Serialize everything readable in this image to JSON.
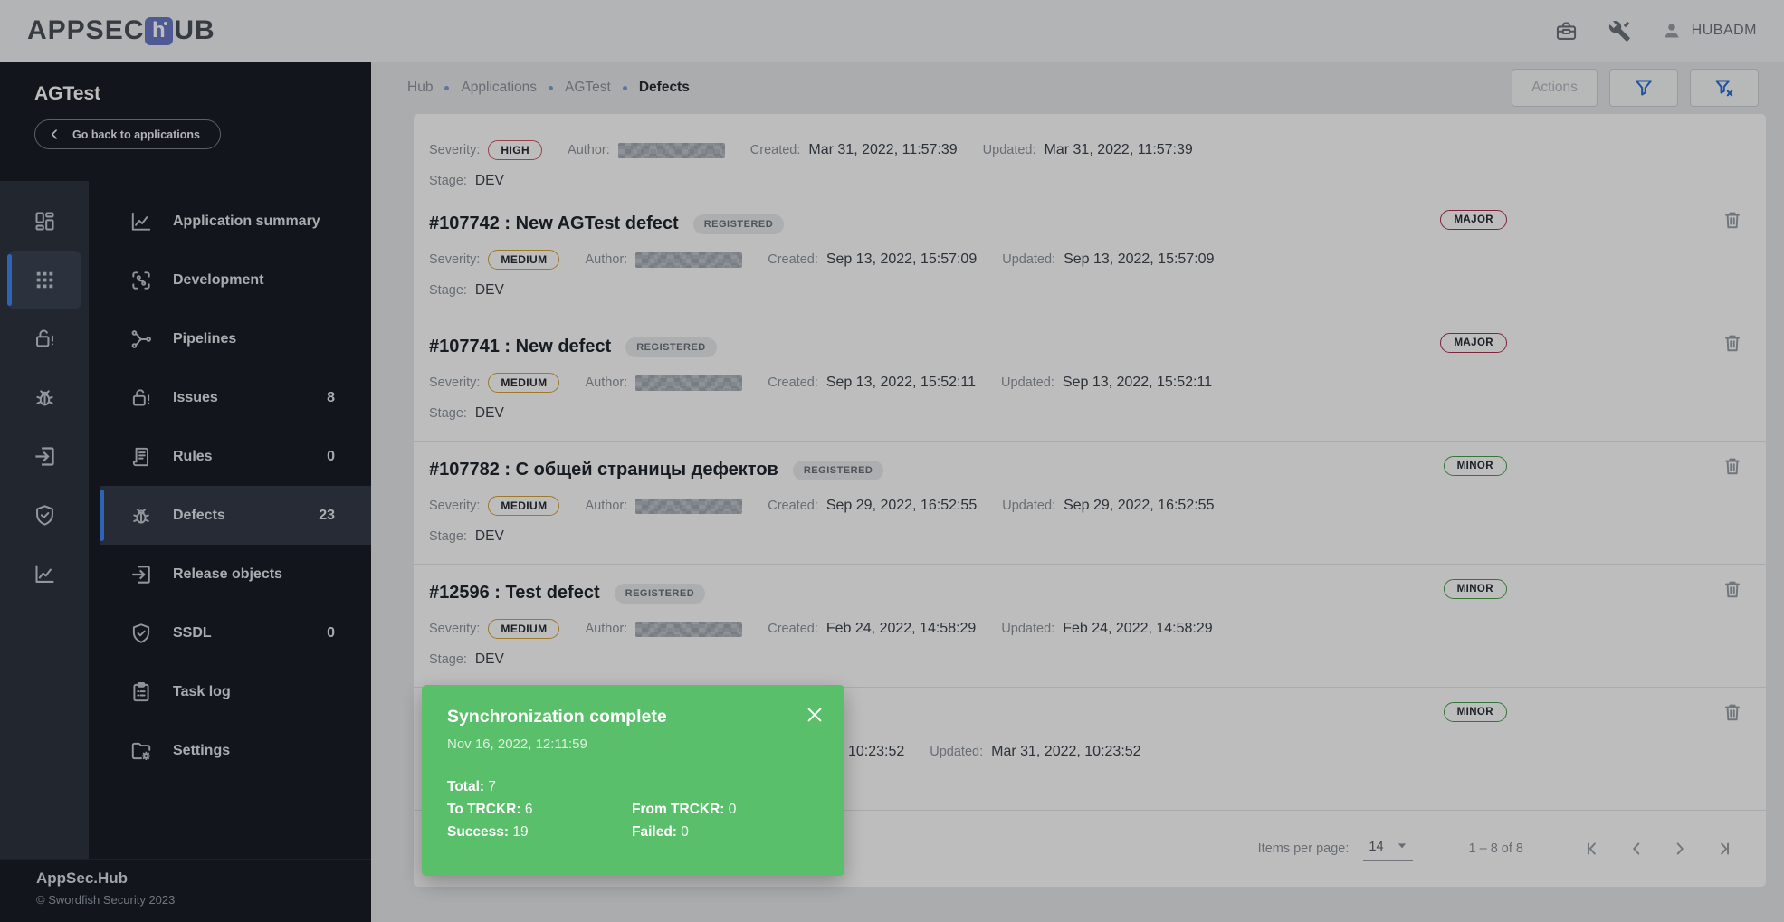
{
  "app_bar": {
    "logo_prefix": "APPSEC",
    "logo_mid": "h",
    "logo_suffix": "UB",
    "user": "HUBADM"
  },
  "icons": {
    "toolbox-icon": "briefcase outline",
    "tools-icon": "crossed wrench tools",
    "person-icon": "user silhouette",
    "chevron-left-icon": "left chevron",
    "filter-icon": "funnel outline",
    "filter-clear-icon": "funnel with x",
    "trash-icon": "trash can outline",
    "close-icon": "x cross",
    "caret-down-icon": "filled down triangle",
    "first-page-icon": "bar + left chevron",
    "chevron-left-nav-icon": "left chevron",
    "chevron-right-nav-icon": "right chevron",
    "last-page-icon": "right chevron + bar"
  },
  "sidebar": {
    "app_name": "AGTest",
    "back_label": "Go back to applications",
    "rail": [
      {
        "name": "dashboard",
        "icon": "dashboard-icon",
        "selected": false
      },
      {
        "name": "applications",
        "icon": "apps-grid-icon",
        "selected": true
      },
      {
        "name": "issues",
        "icon": "lock-alert-icon",
        "selected": false
      },
      {
        "name": "defects",
        "icon": "bug-icon",
        "selected": false
      },
      {
        "name": "release-objects",
        "icon": "exit-icon",
        "selected": false
      },
      {
        "name": "ssdl",
        "icon": "shield-check-icon",
        "selected": false
      },
      {
        "name": "reports",
        "icon": "chart-icon",
        "selected": false
      }
    ],
    "menu": [
      {
        "label": "Application summary",
        "icon": "line-chart-icon",
        "count": "",
        "selected": false
      },
      {
        "label": "Development",
        "icon": "dev-scan-icon",
        "count": "",
        "selected": false
      },
      {
        "label": "Pipelines",
        "icon": "pipelines-icon",
        "count": "",
        "selected": false
      },
      {
        "label": "Issues",
        "icon": "lock-alert-icon",
        "count": "8",
        "selected": false
      },
      {
        "label": "Rules",
        "icon": "rules-icon",
        "count": "0",
        "selected": false
      },
      {
        "label": "Defects",
        "icon": "bug-icon",
        "count": "23",
        "selected": true
      },
      {
        "label": "Release objects",
        "icon": "exit-icon",
        "count": "",
        "selected": false
      },
      {
        "label": "SSDL",
        "icon": "shield-check-icon",
        "count": "0",
        "selected": false
      },
      {
        "label": "Task log",
        "icon": "task-log-icon",
        "count": "",
        "selected": false
      },
      {
        "label": "Settings",
        "icon": "folder-gear-icon",
        "count": "",
        "selected": false
      }
    ],
    "footer_title": "AppSec.Hub",
    "footer_copyright": "© Swordfish Security 2023"
  },
  "breadcrumb": {
    "items": [
      "Hub",
      "Applications",
      "AGTest"
    ],
    "current": "Defects"
  },
  "toolbar": {
    "actions_label": "Actions"
  },
  "labels": {
    "severity": "Severity:",
    "author": "Author:",
    "created": "Created:",
    "updated": "Updated:",
    "stage": "Stage:"
  },
  "defects": [
    {
      "clipped": true,
      "title": "",
      "status": "",
      "severity": "HIGH",
      "created": "Mar 31, 2022, 11:57:39",
      "updated": "Mar 31, 2022, 11:57:39",
      "stage": "DEV",
      "level": ""
    },
    {
      "clipped": false,
      "title": "#107742 : New AGTest defect",
      "status": "REGISTERED",
      "severity": "MEDIUM",
      "created": "Sep 13, 2022, 15:57:09",
      "updated": "Sep 13, 2022, 15:57:09",
      "stage": "DEV",
      "level": "MAJOR"
    },
    {
      "clipped": false,
      "title": "#107741 : New defect",
      "status": "REGISTERED",
      "severity": "MEDIUM",
      "created": "Sep 13, 2022, 15:52:11",
      "updated": "Sep 13, 2022, 15:52:11",
      "stage": "DEV",
      "level": "MAJOR"
    },
    {
      "clipped": false,
      "title": "#107782 : С общей страницы дефектов",
      "status": "REGISTERED",
      "severity": "MEDIUM",
      "created": "Sep 29, 2022, 16:52:55",
      "updated": "Sep 29, 2022, 16:52:55",
      "stage": "DEV",
      "level": "MINOR"
    },
    {
      "clipped": false,
      "title": "#12596 : Test defect",
      "status": "REGISTERED",
      "severity": "MEDIUM",
      "created": "Feb 24, 2022, 14:58:29",
      "updated": "Feb 24, 2022, 14:58:29",
      "stage": "DEV",
      "level": "MINOR"
    },
    {
      "clipped": false,
      "title": "",
      "status": "",
      "severity": "",
      "created": "Mar 31, 2022, 10:23:52",
      "updated": "Mar 31, 2022, 10:23:52",
      "stage": "",
      "level": "MINOR"
    }
  ],
  "pagination": {
    "items_per_page_label": "Items per page:",
    "items_per_page": "14",
    "range": "1 – 8 of 8"
  },
  "toast": {
    "title": "Synchronization complete",
    "timestamp": "Nov 16, 2022, 12:11:59",
    "stat_lines": [
      [
        {
          "label": "Total:",
          "value": "7"
        }
      ],
      [
        {
          "label": "To TRCKR:",
          "value": "6"
        },
        {
          "label": "From TRCKR:",
          "value": "0"
        }
      ],
      [
        {
          "label": "Success:",
          "value": "19"
        },
        {
          "label": "Failed:",
          "value": "0"
        }
      ]
    ]
  },
  "colors": {
    "accent_blue": "#3f87f5",
    "toast_green": "#5abf6a",
    "severity_high": "#cf5a66",
    "severity_medium": "#d4a43c",
    "level_major": "#ad3053",
    "level_minor": "#4a9e4f",
    "sidebar_bg": "#191d26",
    "rail_bg": "#2f343e"
  }
}
